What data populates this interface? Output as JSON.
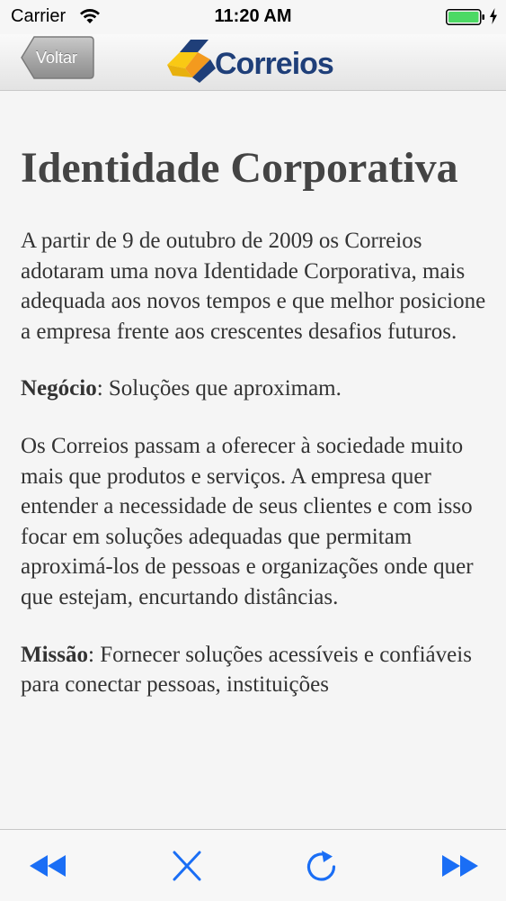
{
  "status_bar": {
    "carrier": "Carrier",
    "time": "11:20 AM",
    "battery_color": "#4cd964"
  },
  "nav": {
    "back_label": "Voltar",
    "brand_name": "Correios",
    "brand_colors": [
      "#f9c914",
      "#f39a1e",
      "#1f3f79"
    ]
  },
  "article": {
    "title": "Identidade Corporativa",
    "intro": "A partir de 9 de outubro de 2009 os Correios adotaram uma nova Identidade Corporativa, mais adequada aos novos tempos e que melhor posicione a empresa frente aos crescentes desafios futuros.",
    "negocio_label": "Negócio",
    "negocio_text": ": Soluções que aproximam.",
    "negocio_body": "Os Correios passam a oferecer à sociedade muito mais que produtos e serviços. A empresa quer entender a necessidade de seus clientes e com isso focar em soluções adequadas que permitam aproximá-los de pessoas e organizações onde quer que estejam, encurtando distâncias.",
    "missao_label": "Missão",
    "missao_text": ": Fornecer soluções acessíveis e confiáveis para conectar pessoas, instituições"
  },
  "toolbar": {
    "accent_color": "#1a6ef5",
    "buttons": [
      "rewind-icon",
      "close-icon",
      "reload-icon",
      "fast-forward-icon"
    ]
  }
}
